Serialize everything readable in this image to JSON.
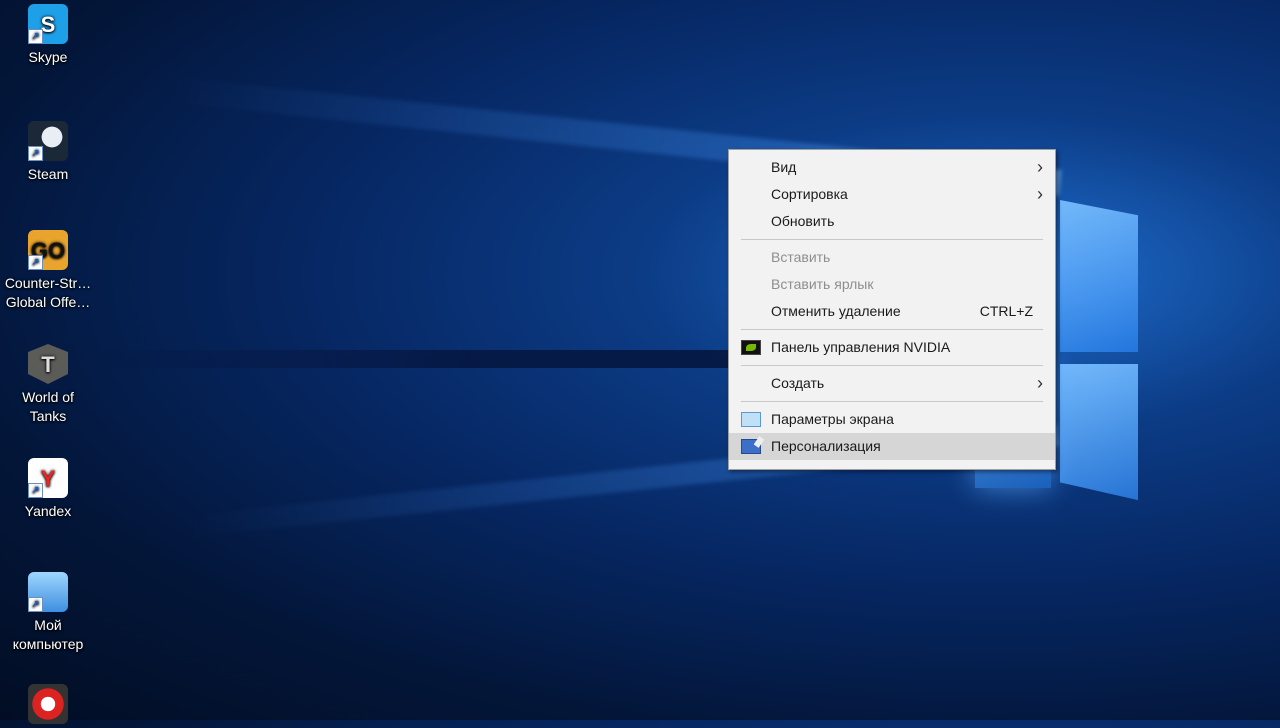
{
  "desktop": {
    "icons": [
      {
        "label": "Skype",
        "glyph": "S",
        "icon": "skype-icon"
      },
      {
        "label": "Steam",
        "glyph": "",
        "icon": "steam-icon"
      },
      {
        "label": "Counter-Str… Global Offe…",
        "glyph": "GO",
        "icon": "csgo-icon"
      },
      {
        "label": "World of Tanks",
        "glyph": "T",
        "icon": "world-of-tanks-icon"
      },
      {
        "label": "Yandex",
        "glyph": "Y",
        "icon": "yandex-icon"
      },
      {
        "label": "Мой компьютер",
        "glyph": "",
        "icon": "my-computer-icon"
      },
      {
        "label": "",
        "glyph": "",
        "icon": "app-icon"
      }
    ],
    "shortcut_arrow": "↗"
  },
  "context_menu": {
    "view": "Вид",
    "sort": "Сортировка",
    "refresh": "Обновить",
    "paste": "Вставить",
    "paste_shortcut": "Вставить ярлык",
    "undo_delete": "Отменить удаление",
    "undo_accel": "CTRL+Z",
    "nvidia": "Панель управления NVIDIA",
    "create": "Создать",
    "display_settings": "Параметры экрана",
    "personalization": "Персонализация",
    "submenu_arrow": "›"
  }
}
